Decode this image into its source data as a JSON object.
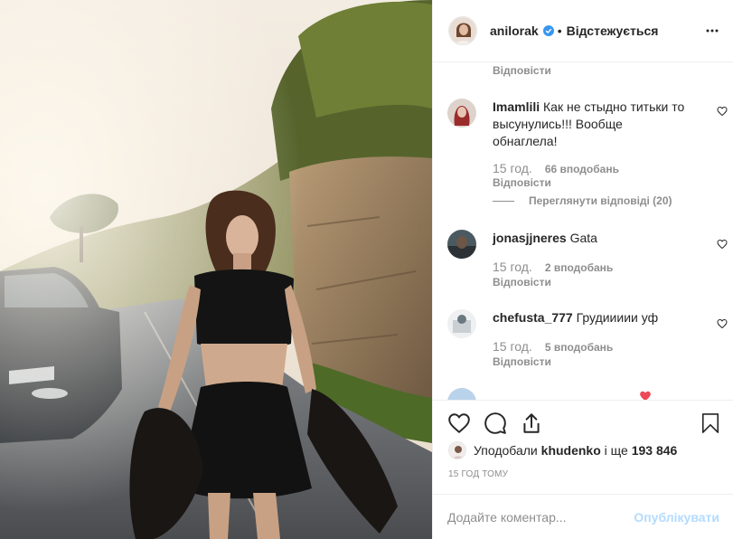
{
  "header": {
    "username": "anilorak",
    "separator": "•",
    "follow_status": "Відстежується"
  },
  "comments": [
    {
      "username": "Imamlili",
      "text": "Как не стыдно титьки то высунулись!!! Вообще обнаглела!",
      "time": "15 год.",
      "likes": "66 вподобань",
      "reply_label": "Відповісти",
      "view_replies": "Переглянути відповіді (20)"
    },
    {
      "username": "jonasjjneres",
      "text": "Gata",
      "time": "15 год.",
      "likes": "2 вподобань",
      "reply_label": "Відповісти"
    },
    {
      "username": "chefusta_777",
      "text": "Грудиииии уф",
      "time": "15 год.",
      "likes": "5 вподобань",
      "reply_label": "Відповісти"
    }
  ],
  "top_reply_label": "Відповісти",
  "likes": {
    "prefix": "Уподобали",
    "user": "khudenko",
    "and": "і ще",
    "count": "193 846"
  },
  "timeago": "15 ГОД ТОМУ",
  "add_comment": {
    "placeholder": "Додайте коментар...",
    "publish_label": "Опублікувати"
  },
  "colors": {
    "text": "#262626",
    "muted": "#8e8e8e",
    "verified": "#3897f0",
    "publish_disabled": "#b3dbff",
    "heart_red": "#ed4956"
  },
  "icons": [
    "verified-badge-icon",
    "more-options-icon",
    "heart-icon",
    "comment-icon",
    "share-icon",
    "bookmark-icon"
  ]
}
